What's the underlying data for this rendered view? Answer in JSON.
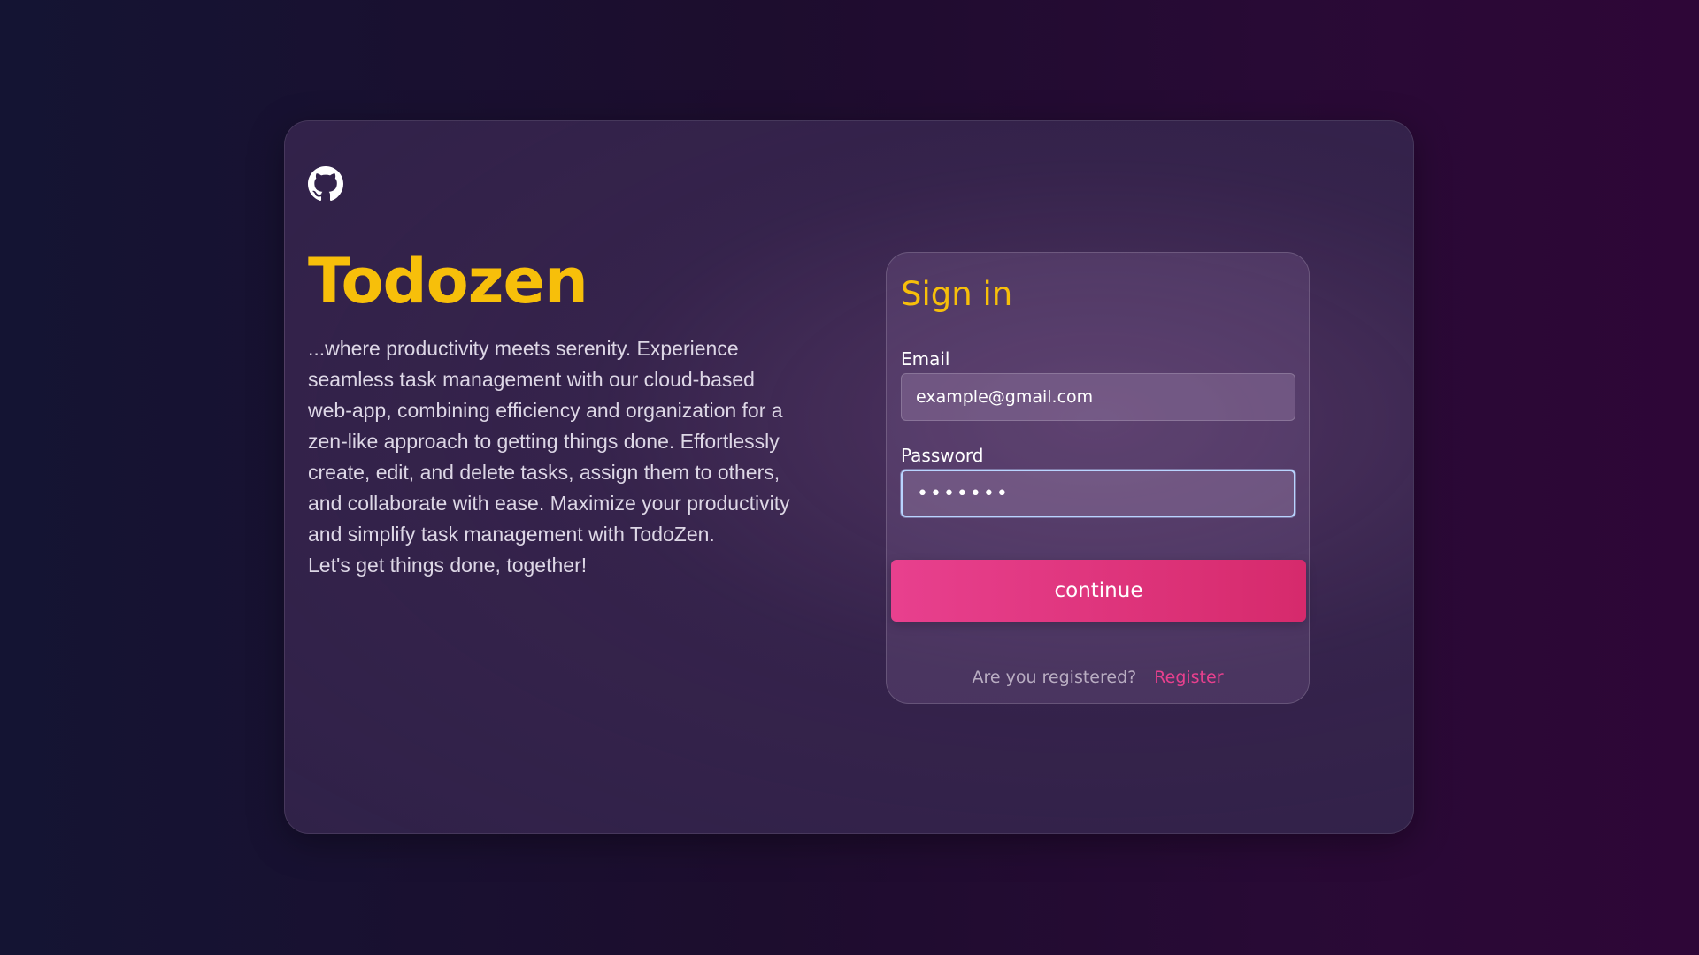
{
  "app": {
    "brand": "Todozen",
    "tagline": "...where productivity meets serenity. Experience seamless task management with our cloud-based web-app, combining efficiency and organization for a zen-like approach to getting things done. Effortlessly create, edit, and delete tasks, assign them to others, and collaborate with ease. Maximize your productivity and simplify task management with TodoZen.\nLet's get things done, together!",
    "github_icon": "github-icon"
  },
  "signin": {
    "title": "Sign in",
    "email_label": "Email",
    "email_placeholder": "example@gmail.com",
    "email_value": "",
    "password_label": "Password",
    "password_value": "1234567",
    "continue_label": "continue",
    "register_question": "Are you registered?",
    "register_link": "Register"
  },
  "colors": {
    "accent_yellow": "#f7bf0a",
    "accent_pink": "#e8408e",
    "focus_border": "#b9d4ff"
  }
}
